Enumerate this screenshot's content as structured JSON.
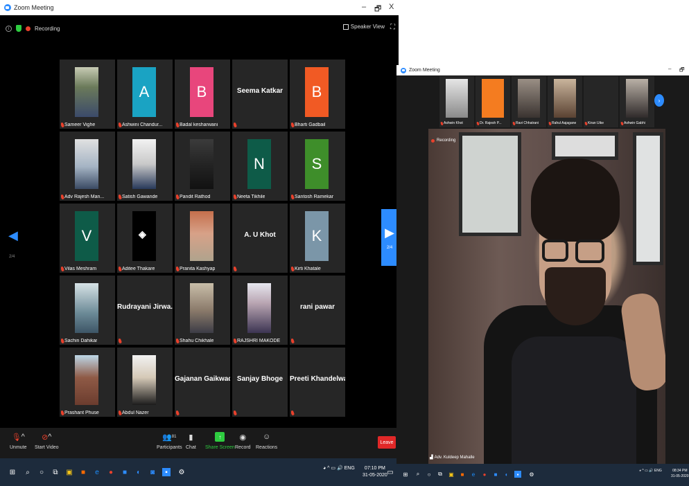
{
  "left_window": {
    "title": "Zoom Meeting",
    "controls": {
      "minimize": "–",
      "restore": "🗗",
      "close": "X"
    },
    "recording_label": "Recording",
    "speaker_view_label": "Speaker View",
    "page_indicator_left": "2/4",
    "page_indicator_right": "2/4",
    "participants": [
      {
        "name": "Sameer Vighe",
        "kind": "photo",
        "style": "p1"
      },
      {
        "name": "Ashwini Chandur...",
        "kind": "letter",
        "letter": "A",
        "color": "#1aa3c3"
      },
      {
        "name": "Badal kesharwani",
        "kind": "letter",
        "letter": "B",
        "color": "#e8467c"
      },
      {
        "name": "",
        "kind": "name",
        "display_name": "Seema Katkar"
      },
      {
        "name": "Bharti Gadbail",
        "kind": "letter",
        "letter": "B",
        "color": "#f15a24"
      },
      {
        "name": "Adv Rajesh Man...",
        "kind": "photo",
        "style": "p2"
      },
      {
        "name": "Satish Gawande",
        "kind": "photo",
        "style": "p3"
      },
      {
        "name": "Pandit Rathod",
        "kind": "photo",
        "style": "p4"
      },
      {
        "name": "Neeta Tikhile",
        "kind": "letter",
        "letter": "N",
        "color": "#0e5b48"
      },
      {
        "name": "Santosh Ramekar",
        "kind": "letter",
        "letter": "S",
        "color": "#3e8e2a"
      },
      {
        "name": "Vilas Meshram",
        "kind": "letter",
        "letter": "V",
        "color": "#0e5b48"
      },
      {
        "name": "Aditee Thakare",
        "kind": "logo"
      },
      {
        "name": "Pranita Kashyap",
        "kind": "photo",
        "style": "p5"
      },
      {
        "name": "",
        "kind": "name",
        "display_name": "A. U Khot"
      },
      {
        "name": "Kirti Khatale",
        "kind": "letter",
        "letter": "K",
        "color": "#7b96a8"
      },
      {
        "name": "Sachin Dahikar",
        "kind": "photo",
        "style": "p6"
      },
      {
        "name": "",
        "kind": "name",
        "display_name": "Rudrayani Jirwa..."
      },
      {
        "name": "Shahu Chikhale",
        "kind": "photo",
        "style": "p7"
      },
      {
        "name": "RAJSHRI MAKODE",
        "kind": "photo",
        "style": "p8"
      },
      {
        "name": "",
        "kind": "name",
        "display_name": "rani pawar"
      },
      {
        "name": "Prashant Phuse",
        "kind": "photo",
        "style": "p9"
      },
      {
        "name": "Abdul Nazer",
        "kind": "photo",
        "style": "p10"
      },
      {
        "name": "",
        "kind": "name",
        "display_name": "Gajanan Gaikwad"
      },
      {
        "name": "",
        "kind": "name",
        "display_name": "Sanjay Bhoge"
      },
      {
        "name": "",
        "kind": "name",
        "display_name": "Preeti Khandelwal"
      }
    ],
    "toolbar": {
      "unmute": "Unmute",
      "start_video": "Start Video",
      "participants": "Participants",
      "participants_count": "81",
      "chat": "Chat",
      "share_screen": "Share Screen",
      "record": "Record",
      "reactions": "Reactions",
      "leave": "Leave"
    },
    "taskbar": {
      "time": "07:10 PM",
      "date": "31-05-2020",
      "lang": "ENG"
    }
  },
  "right_window": {
    "title": "Zoom Meeting",
    "controls": {
      "minimize": "–",
      "restore": "🗗"
    },
    "recording_label": "Recording",
    "thumbnails": [
      {
        "name": "Ashwin Khot"
      },
      {
        "name": "Dr. Rajesh P..."
      },
      {
        "name": "Ravi Chhatrani"
      },
      {
        "name": "Rahul Aajagane"
      },
      {
        "name": "Kiran Uike"
      },
      {
        "name": "Ashwin Gabhi"
      }
    ],
    "main_speaker": "Adv. Kuldeep Mahalle",
    "taskbar": {
      "time": "08:34 PM",
      "date": "31-05-2020",
      "lang": "ENG"
    }
  },
  "colors": {
    "zoom_blue": "#2d8cff",
    "leave_red": "#e02828",
    "mic_red": "#e8412c",
    "share_green": "#2ecc40"
  }
}
